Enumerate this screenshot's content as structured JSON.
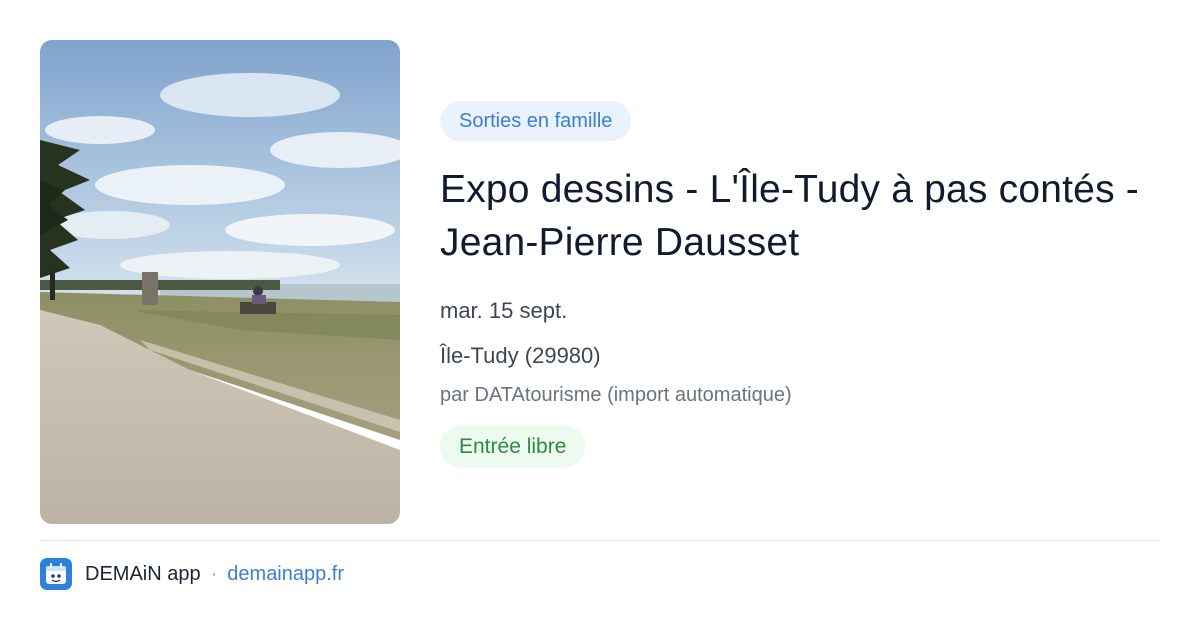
{
  "event": {
    "category": "Sorties en famille",
    "title": "Expo dessins - L'Île-Tudy à pas contés - Jean-Pierre Dausset",
    "date": "mar. 15 sept.",
    "location": "Île-Tudy (29980)",
    "source": "par DATAtourisme (import automatique)",
    "price": "Entrée libre"
  },
  "footer": {
    "app_name": "DEMAiN app",
    "separator": "·",
    "domain": "demainapp.fr"
  },
  "colors": {
    "category_bg": "#e9f2fd",
    "category_text": "#3b7fd4",
    "price_bg": "#edfaf0",
    "price_text": "#2f8a42",
    "app_icon": "#2f7fe0",
    "link": "#3b7fd4"
  },
  "icons": {
    "app_icon": "demain-app-icon"
  }
}
